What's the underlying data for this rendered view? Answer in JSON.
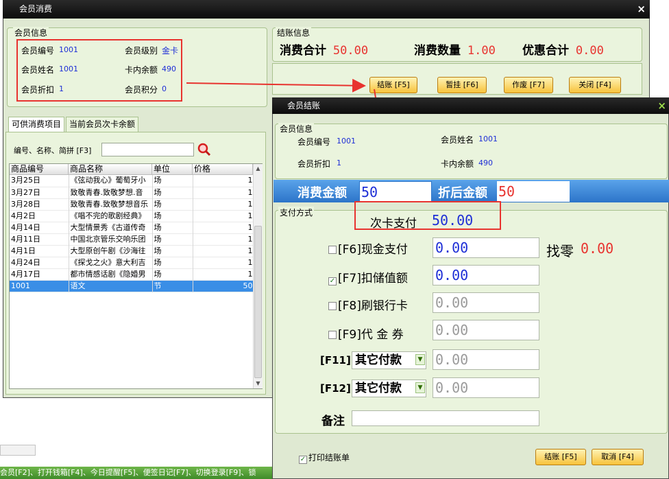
{
  "main_window": {
    "title": "会员消费",
    "close": "×",
    "member_info": {
      "title": "会员信息",
      "id_label": "会员编号",
      "id_value": "1001",
      "level_label": "会员级别",
      "level_value": "金卡",
      "name_label": "会员姓名",
      "name_value": "1001",
      "balance_label": "卡内余额",
      "balance_value": "490",
      "discount_label": "会员折扣",
      "discount_value": "1",
      "points_label": "会员积分",
      "points_value": "0"
    },
    "checkout_info": {
      "title": "结账信息",
      "total_label": "消费合计",
      "total_value": "50.00",
      "qty_label": "消费数量",
      "qty_value": "1.00",
      "discount_label": "优惠合计",
      "discount_value": "0.00"
    },
    "buttons": {
      "checkout": "结账 [F5]",
      "hold": "暂挂 [F6]",
      "void": "作废 [F7]",
      "close": "关闭 [F4]"
    },
    "tabs": [
      "可供消费项目",
      "当前会员次卡余额"
    ],
    "search": {
      "label": "编号、名称、简拼 [F3]",
      "value": ""
    },
    "table": {
      "columns": [
        "商品编号",
        "商品名称",
        "单位",
        "价格"
      ],
      "rows": [
        {
          "code": "3月25日",
          "name": "《弦动我心》葡萄牙小",
          "unit": "场",
          "price": "1"
        },
        {
          "code": "3月27日",
          "name": "致敬青春.致敬梦想.音",
          "unit": "场",
          "price": "1"
        },
        {
          "code": "3月28日",
          "name": "致敬青春.致敬梦想音乐",
          "unit": "场",
          "price": "1"
        },
        {
          "code": "4月2日",
          "name": "《唱不完的歌剧经典》",
          "unit": "场",
          "price": "1"
        },
        {
          "code": "4月14日",
          "name": "大型情景秀《古道传奇",
          "unit": "场",
          "price": "1"
        },
        {
          "code": "4月11日",
          "name": "中国北京管乐交响乐团",
          "unit": "场",
          "price": "1"
        },
        {
          "code": "4月1日",
          "name": "大型原创午剧《沙海往",
          "unit": "场",
          "price": "1"
        },
        {
          "code": "4月24日",
          "name": "《探戈之火》意大利吉",
          "unit": "场",
          "price": "1"
        },
        {
          "code": "4月17日",
          "name": "都市情感话剧《隐婚男",
          "unit": "场",
          "price": "1"
        },
        {
          "code": "1001",
          "name": "语文",
          "unit": "节",
          "price": "50"
        }
      ]
    }
  },
  "dialog": {
    "title": "会员结账",
    "close": "×",
    "member_info": {
      "title": "会员信息",
      "id_label": "会员编号",
      "id_value": "1001",
      "name_label": "会员姓名",
      "name_value": "1001",
      "discount_label": "会员折扣",
      "discount_value": "1",
      "balance_label": "卡内余额",
      "balance_value": "490"
    },
    "amount_label": "消费金额",
    "amount_value": "50",
    "after_discount_label": "折后金额",
    "after_discount_value": "50",
    "payment": {
      "title": "支付方式",
      "card_label": "次卡支付",
      "card_value": "50.00",
      "cash": {
        "label": "[F6]现金支付",
        "value": "0.00",
        "checked": false
      },
      "change_label": "找零",
      "change_value": "0.00",
      "stored": {
        "label": "[F7]扣储值额",
        "value": "0.00",
        "checked": true
      },
      "bankcard": {
        "label": "[F8]刷银行卡",
        "value": "0.00",
        "checked": false
      },
      "voucher": {
        "label": "[F9]代 金 券",
        "value": "0.00",
        "checked": false
      },
      "other1": {
        "key": "[F11]",
        "select": "其它付款",
        "value": "0.00"
      },
      "other2": {
        "key": "[F12]",
        "select": "其它付款",
        "value": "0.00"
      },
      "note_label": "备注",
      "note_value": ""
    },
    "print_label": "打印结账单",
    "print_checked": true,
    "checkout_button": "结账 [F5]",
    "cancel_button": "取消 [F4]"
  },
  "statusbar": "会员[F2]、打开钱箱[F4]、今日提醒[F5]、便签日记[F7]、切换登录[F9]、锁",
  "colors": {
    "accent_red": "#e8332f",
    "value_blue": "#1d2ed6",
    "panel_green": "#eaf4dd",
    "band_blue": "#2f7fd4"
  }
}
